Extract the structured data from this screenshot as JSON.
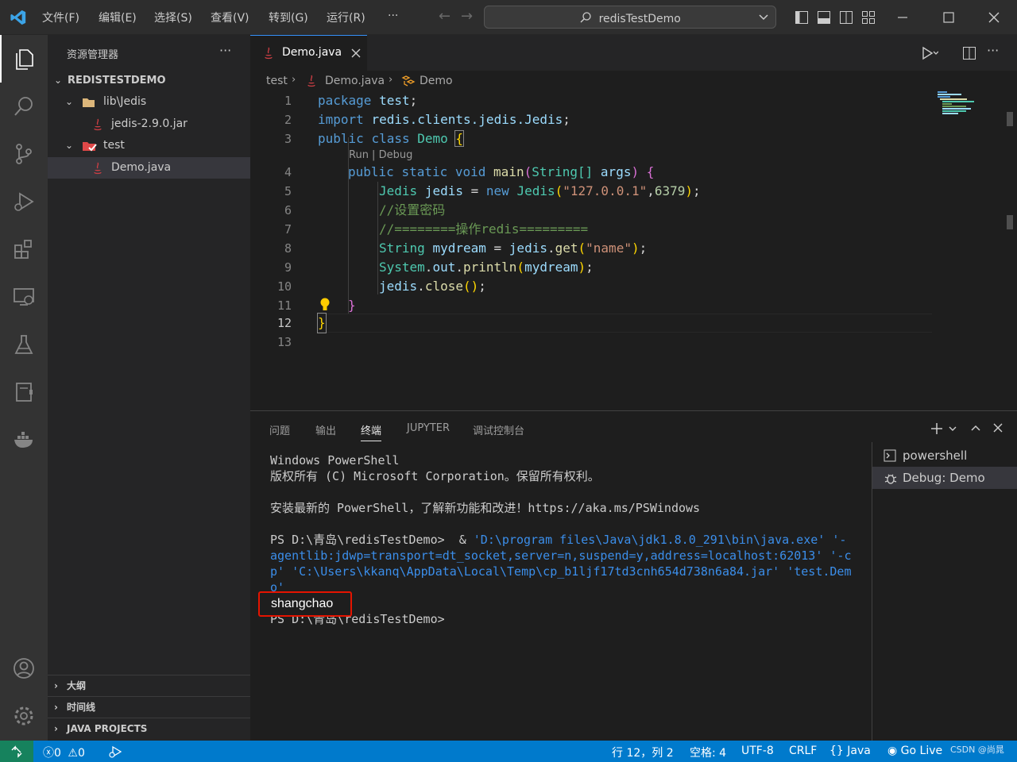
{
  "titlebar": {
    "menus": [
      "文件(F)",
      "编辑(E)",
      "选择(S)",
      "查看(V)",
      "转到(G)",
      "运行(R)",
      "···"
    ],
    "search": "redisTestDemo"
  },
  "sidebar": {
    "title": "资源管理器",
    "more": "···",
    "project": "REDISTESTDEMO",
    "tree": [
      {
        "label": "lib\\Jedis"
      },
      {
        "label": "jedis-2.9.0.jar"
      },
      {
        "label": "test"
      },
      {
        "label": "Demo.java"
      }
    ],
    "sections": [
      "大纲",
      "时间线",
      "JAVA PROJECTS"
    ]
  },
  "editor": {
    "tab_label": "Demo.java",
    "breadcrumb": [
      "test",
      "Demo.java",
      "Demo"
    ],
    "codelens": "Run | Debug",
    "line_numbers": [
      "1",
      "2",
      "3",
      "4",
      "5",
      "6",
      "7",
      "8",
      "9",
      "10",
      "11",
      "12",
      "13"
    ],
    "code": {
      "l1_kw": "package",
      "l1_name": "test",
      "l1_semi": ";",
      "l2_kw": "import",
      "l2_path": "redis.clients.jedis.Jedis",
      "l2_semi": ";",
      "l3_kw1": "public",
      "l3_kw2": "class",
      "l3_name": "Demo",
      "l3_brace": "{",
      "l4_kw1": "public",
      "l4_kw2": "static",
      "l4_kw3": "void",
      "l4_fn": "main",
      "l4_p1": "(",
      "l4_type": "String[]",
      "l4_arg": "args",
      "l4_p2": ")",
      "l4_brace": "{",
      "l5_type": "Jedis",
      "l5_var": "jedis",
      "l5_eq": "=",
      "l5_new": "new",
      "l5_cls": "Jedis",
      "l5_p1": "(",
      "l5_str": "\"127.0.0.1\"",
      "l5_comma": ",",
      "l5_num": "6379",
      "l5_p2": ")",
      "l5_semi": ";",
      "l6_comment": "//设置密码",
      "l7_comment": "//========操作redis=========",
      "l8_type": "String",
      "l8_var": "mydream",
      "l8_eq": "=",
      "l8_obj": "jedis",
      "l8_dot": ".",
      "l8_fn": "get",
      "l8_p1": "(",
      "l8_str": "\"name\"",
      "l8_p2": ")",
      "l8_semi": ";",
      "l9_cls": "System",
      "l9_dot1": ".",
      "l9_field": "out",
      "l9_dot2": ".",
      "l9_fn": "println",
      "l9_p1": "(",
      "l9_arg": "mydream",
      "l9_p2": ")",
      "l9_semi": ";",
      "l10_obj": "jedis",
      "l10_dot": ".",
      "l10_fn": "close",
      "l10_parens": "()",
      "l10_semi": ";",
      "l11_brace": "}",
      "l12_brace": "}"
    }
  },
  "panel": {
    "tabs": [
      "问题",
      "输出",
      "终端",
      "JUPYTER",
      "调试控制台"
    ],
    "active_tab": "终端",
    "terminal": {
      "line1": "Windows PowerShell",
      "line2": "版权所有 (C) Microsoft Corporation。保留所有权利。",
      "line3": "安装最新的 PowerShell，了解新功能和改进！https://aka.ms/PSWindows",
      "prompt": "PS D:\\青岛\\redisTestDemo>",
      "cmd_amp": "&",
      "cmd_part1": "'D:\\program files\\Java\\jdk1.8.0_291\\bin\\java.exe' '-",
      "cmd_part2": "agentlib:jdwp=transport=dt_socket,server=n,suspend=y,address=localhost:62013' '-c",
      "cmd_part3": "p' 'C:\\Users\\kkanq\\AppData\\Local\\Temp\\cp_b1ljf17td3cnh654d738n6a84.jar' 'test.Dem",
      "cmd_part4": "o'",
      "output": "shangchao",
      "prompt2": "PS D:\\青岛\\redisTestDemo>"
    },
    "terminals": [
      "powershell",
      "Debug: Demo"
    ]
  },
  "statusbar": {
    "errors": "0",
    "warnings": "0",
    "position": "行 12，列 2",
    "spaces": "空格: 4",
    "encoding": "UTF-8",
    "eol": "CRLF",
    "language": "Java",
    "golive": "Go Live",
    "watermark": "CSDN @尚晁"
  },
  "colors": {
    "accent": "#007acc",
    "highlight_box": "#e51400",
    "keyword": "#569cd6",
    "type": "#4ec9b0",
    "string": "#ce9178",
    "comment": "#6a9955"
  }
}
